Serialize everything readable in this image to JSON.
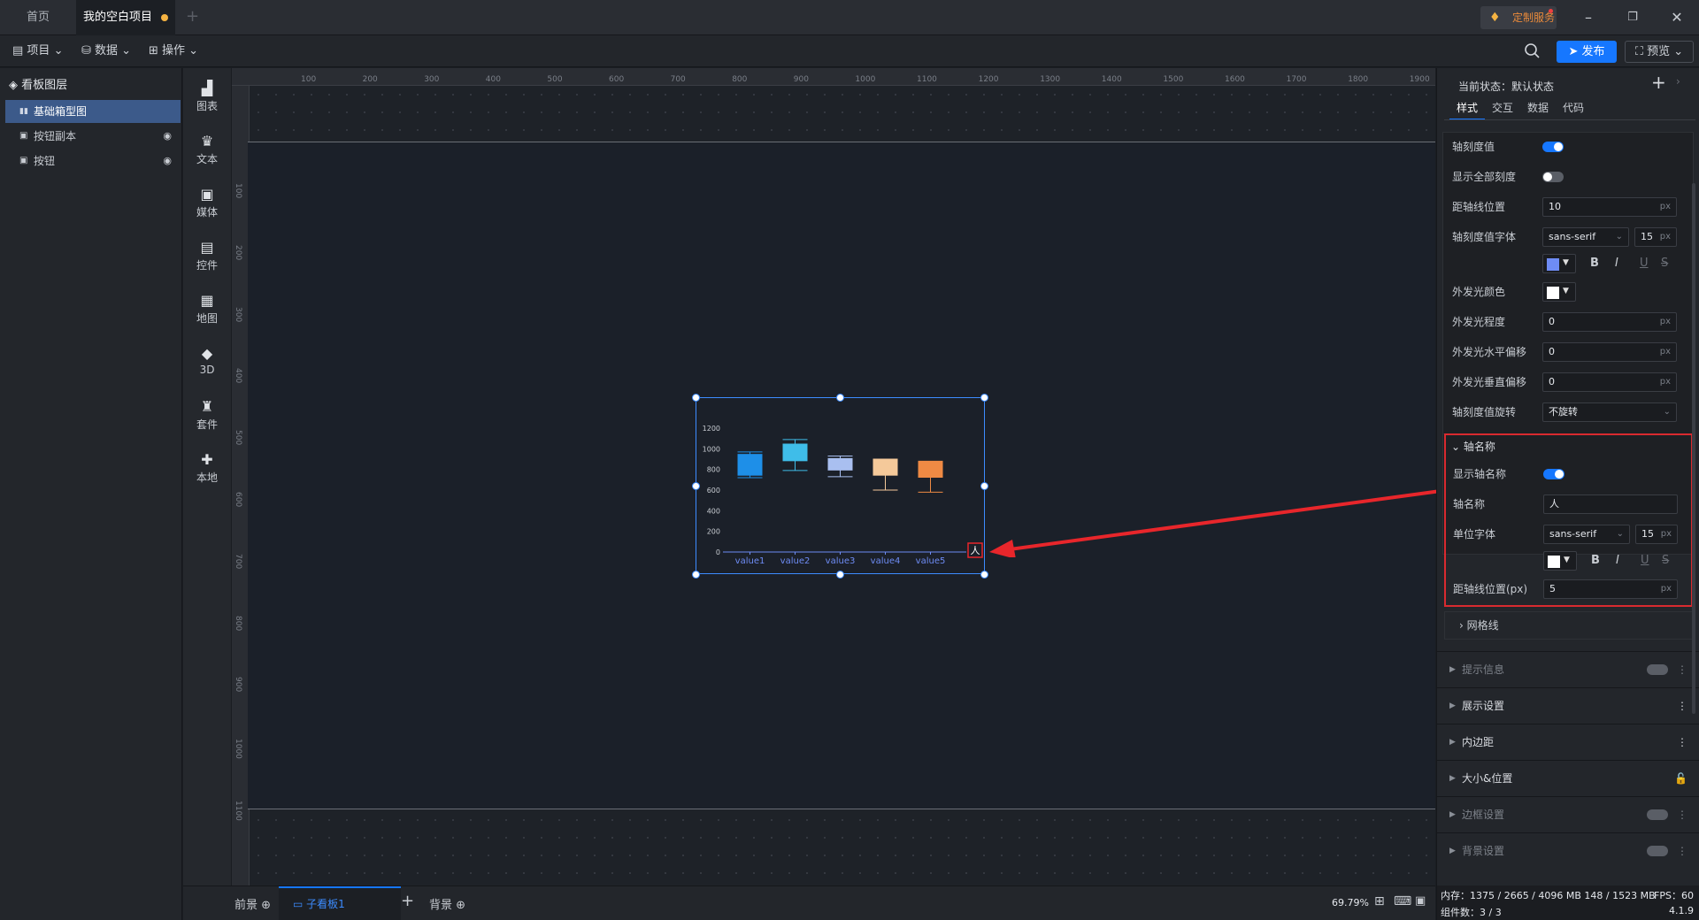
{
  "tabs": [
    {
      "label": "首页",
      "active": false
    },
    {
      "label": "我的空白项目",
      "active": true
    }
  ],
  "custom_service": "定制服务",
  "menus": [
    "项目",
    "数据",
    "操作"
  ],
  "publish_label": "发布",
  "preview_label": "预览",
  "layers": {
    "title": "看板图层",
    "items": [
      {
        "label": "基础箱型图",
        "selected": true
      },
      {
        "label": "按钮副本",
        "selected": false
      },
      {
        "label": "按钮",
        "selected": false
      }
    ]
  },
  "components": [
    "图表",
    "文本",
    "媒体",
    "控件",
    "地图",
    "3D",
    "套件",
    "本地"
  ],
  "ruler_h": [
    "100",
    "200",
    "300",
    "400",
    "500",
    "600",
    "700",
    "800",
    "900",
    "1000",
    "1100",
    "1200",
    "1300",
    "1400",
    "1500",
    "1600",
    "1700",
    "1800",
    "1900"
  ],
  "ruler_v": [
    "100",
    "200",
    "300",
    "400",
    "500",
    "600",
    "700",
    "800",
    "900",
    "1000",
    "1100"
  ],
  "chart_data": {
    "type": "boxplot",
    "categories": [
      "value1",
      "value2",
      "value3",
      "value4",
      "value5"
    ],
    "yticks": [
      "0",
      "200",
      "400",
      "600",
      "800",
      "1000",
      "1200"
    ],
    "ylim": [
      0,
      1200
    ],
    "boxes": [
      {
        "min": 720,
        "q1": 740,
        "q3": 950,
        "max": 970,
        "color": "#1e8fe8"
      },
      {
        "min": 790,
        "q1": 880,
        "q3": 1050,
        "max": 1090,
        "color": "#3fbde9"
      },
      {
        "min": 730,
        "q1": 790,
        "q3": 910,
        "max": 930,
        "color": "#a9bff0"
      },
      {
        "min": 600,
        "q1": 740,
        "q3": 900,
        "max": 900,
        "color": "#f5c99a"
      },
      {
        "min": 580,
        "q1": 720,
        "q3": 880,
        "max": 880,
        "color": "#ef8a44"
      }
    ],
    "axis_name": "人"
  },
  "bottom": {
    "front": "前景",
    "sub_board": "子看板1",
    "back": "背景",
    "zoom": "69.79%"
  },
  "panel": {
    "state": "当前状态：默认状态",
    "tabs": [
      "样式",
      "交互",
      "数据",
      "代码"
    ],
    "rows": {
      "tick_value": "轴刻度值",
      "show_all_ticks": "显示全部刻度",
      "axis_distance": "距轴线位置",
      "axis_distance_val": "10",
      "tick_font": "轴刻度值字体",
      "font_name": "sans-serif",
      "font_size": "15",
      "glow_color": "外发光颜色",
      "glow_level": "外发光程度",
      "glow_level_val": "0",
      "glow_h": "外发光水平偏移",
      "glow_h_val": "0",
      "glow_v": "外发光垂直偏移",
      "glow_v_val": "0",
      "tick_rotate": "轴刻度值旋转",
      "tick_rotate_val": "不旋转"
    },
    "axis_name_section": {
      "title": "轴名称",
      "show_label": "显示轴名称",
      "name_label": "轴名称",
      "name_val": "人",
      "unit_font": "单位字体",
      "font_name": "sans-serif",
      "font_size": "15",
      "distance_label": "距轴线位置(px)",
      "distance_val": "5"
    },
    "gridline": "网格线",
    "sections": [
      "提示信息",
      "展示设置",
      "内边距",
      "大小&位置",
      "边框设置",
      "背景设置"
    ],
    "unit": "px",
    "fmt": [
      "B",
      "I",
      "U",
      "S"
    ]
  },
  "status": {
    "memory": "内存：1375 / 2665 / 4096 MB  148 / 1523 MB",
    "fps": "FPS：60",
    "components": "组件数：3 / 3",
    "version": "4.1.9"
  }
}
